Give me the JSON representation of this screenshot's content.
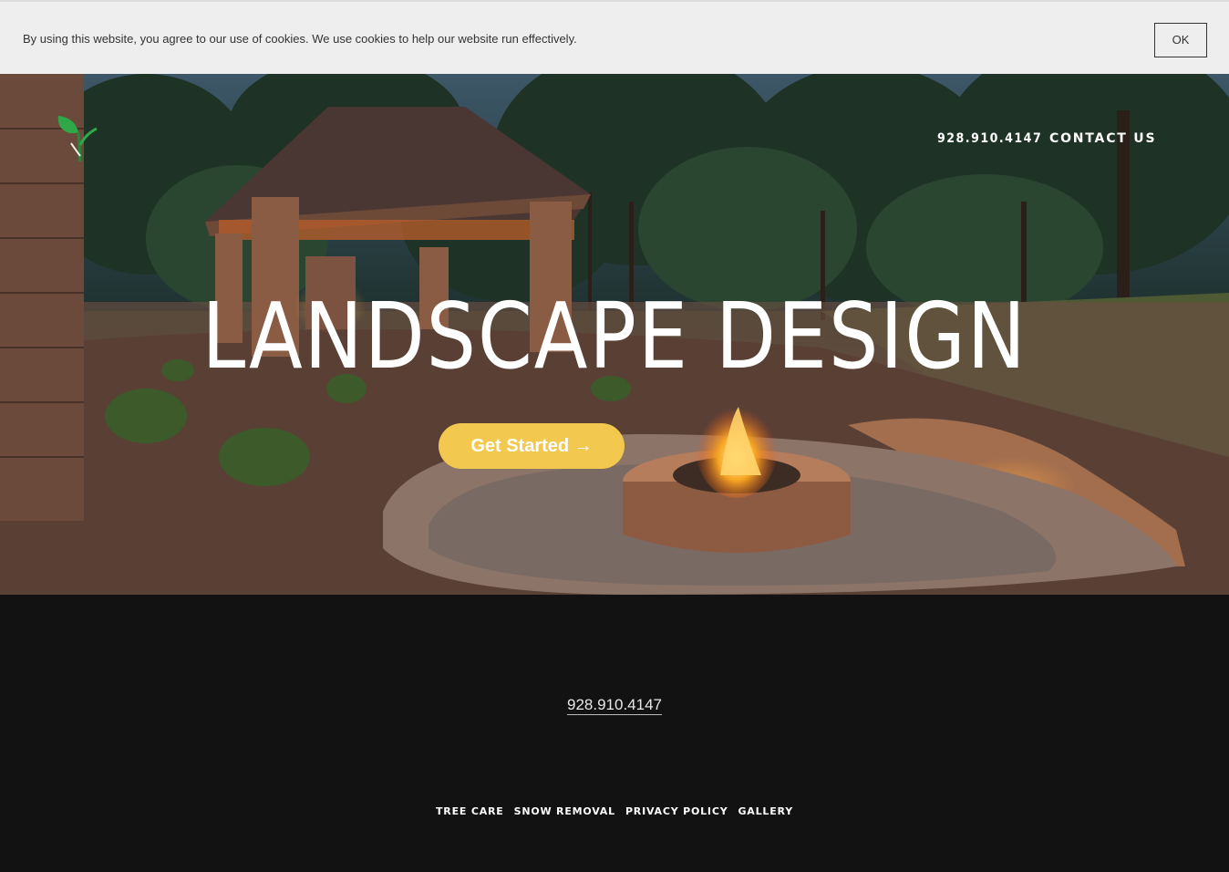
{
  "cookie_banner": {
    "message": "By using this website, you agree to our use of cookies. We use cookies to help our website run effectively.",
    "ok_label": "OK"
  },
  "header": {
    "phone": "928.910.4147",
    "contact": "CONTACT US"
  },
  "hero": {
    "title": "LANDSCAPE DESIGN",
    "cta_label": "Get Started →"
  },
  "footer": {
    "phone": "928.910.4147",
    "links": [
      "TREE CARE",
      "SNOW REMOVAL",
      "PRIVACY POLICY",
      "GALLERY"
    ]
  },
  "colors": {
    "accent": "#f2c84f",
    "footer_bg": "#121212",
    "cookie_bg": "#eeeeee"
  }
}
